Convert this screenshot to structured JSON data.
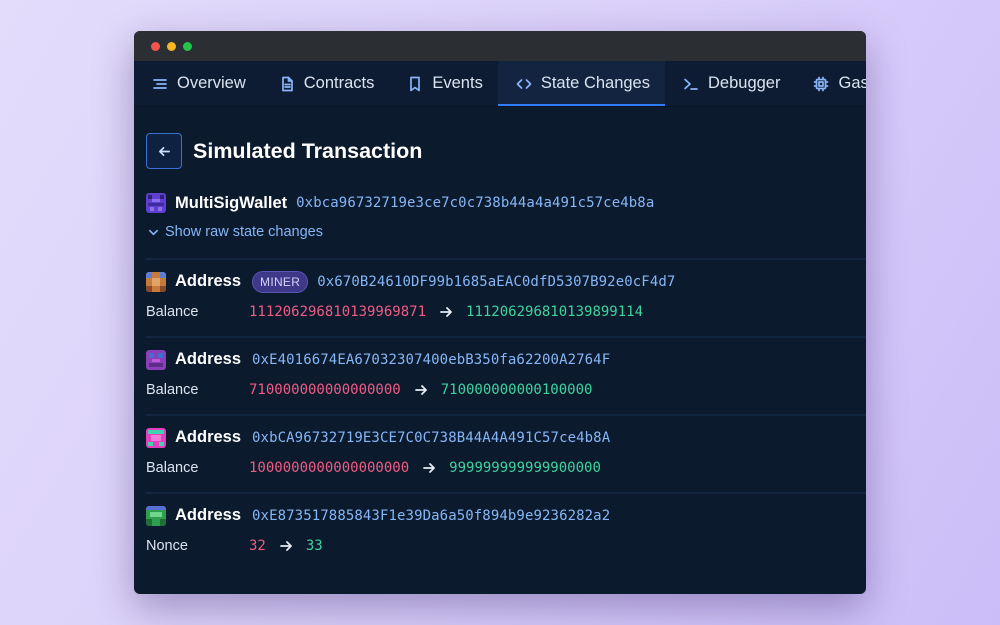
{
  "tabs": [
    {
      "label": "Overview",
      "icon": "list-icon",
      "active": false
    },
    {
      "label": "Contracts",
      "icon": "document-icon",
      "active": false
    },
    {
      "label": "Events",
      "icon": "bookmark-icon",
      "active": false
    },
    {
      "label": "State Changes",
      "icon": "code-icon",
      "active": true
    },
    {
      "label": "Debugger",
      "icon": "terminal-icon",
      "active": false
    },
    {
      "label": "Gas",
      "icon": "chip-icon",
      "active": false
    }
  ],
  "page": {
    "title": "Simulated Transaction",
    "back_icon": "arrow-left-icon"
  },
  "contract": {
    "name": "MultiSigWallet",
    "address": "0xbca96732719e3ce7c0c738b44a4a491c57ce4b8a",
    "raw_toggle_label": "Show raw state changes"
  },
  "changes": [
    {
      "label": "Address",
      "badge": "MINER",
      "address": "0x670B24610DF99b1685aEAC0dfD5307B92e0cF4d7",
      "field": "Balance",
      "old": "111206296810139969871",
      "new": "111206296810139899114",
      "avatar_colors": [
        "#c77a3a",
        "#5a7fd6"
      ]
    },
    {
      "label": "Address",
      "badge": "",
      "address": "0xE4016674EA67032307400ebB350fa62200A2764F",
      "field": "Balance",
      "old": "710000000000000000",
      "new": "710000000000100000",
      "avatar_colors": [
        "#8a3fb8",
        "#3f6fd0"
      ]
    },
    {
      "label": "Address",
      "badge": "",
      "address": "0xbCA96732719E3CE7C0C738B44A4A491C57ce4b8A",
      "field": "Balance",
      "old": "1000000000000000000",
      "new": "999999999999900000",
      "avatar_colors": [
        "#e23fbf",
        "#3fd3b0"
      ]
    },
    {
      "label": "Address",
      "badge": "",
      "address": "0xE873517885843F1e39Da6a50f894b9e9236282a2",
      "field": "Nonce",
      "old": "32",
      "new": "33",
      "avatar_colors": [
        "#2e9e4f",
        "#5a6fd6"
      ]
    }
  ],
  "colors": {
    "accent": "#2f7cf6",
    "old_value": "#ef5c84",
    "new_value": "#3fd39d",
    "address": "#86b6f6"
  }
}
